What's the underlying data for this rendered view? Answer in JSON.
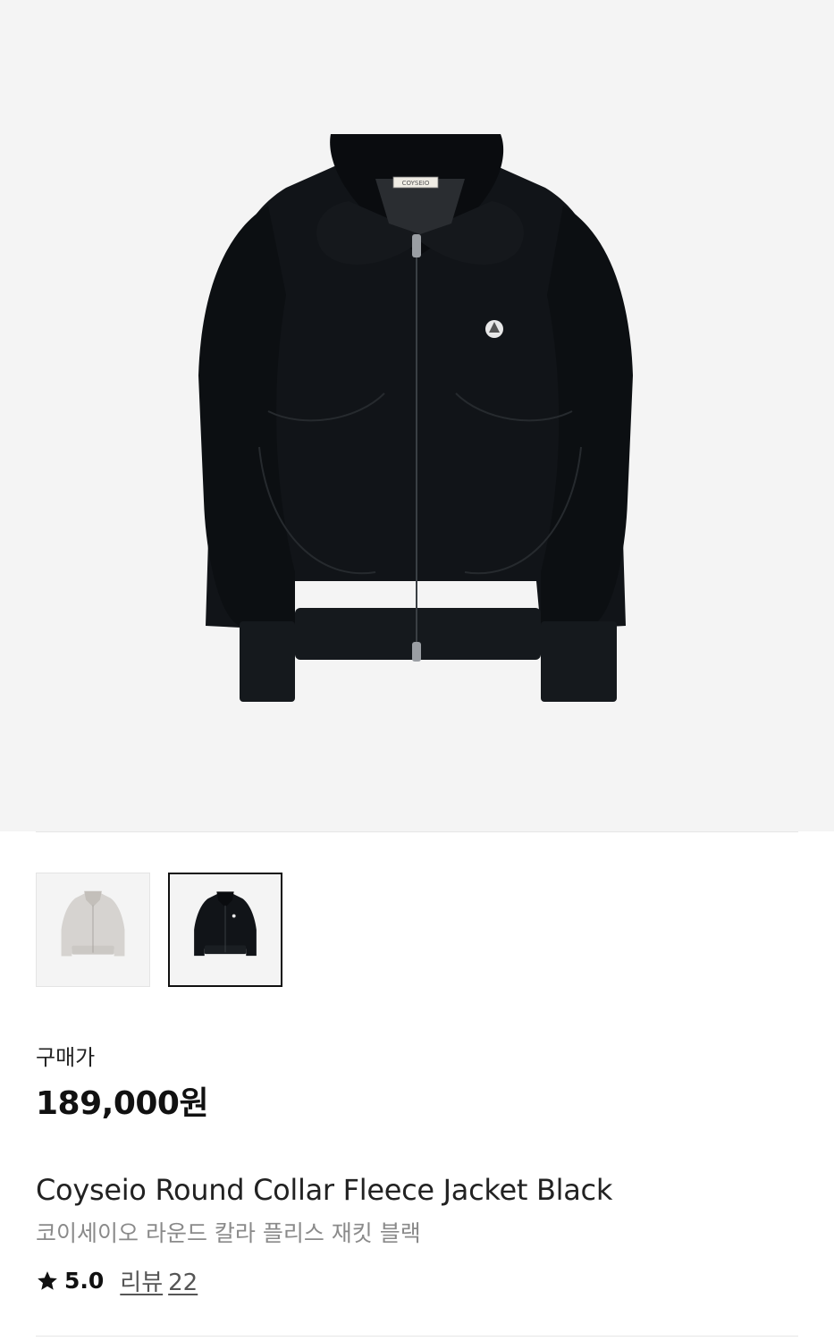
{
  "product": {
    "main_image": {
      "icon": "black-fleece-jacket-image",
      "background": "#f4f4f4"
    },
    "label_text": "COYSEIO",
    "thumbnails": [
      {
        "icon": "gray-jacket-thumbnail",
        "color": "#dcdad8",
        "selected": false
      },
      {
        "icon": "black-jacket-thumbnail",
        "color": "#111418",
        "selected": true
      }
    ],
    "price_label": "구매가",
    "price": "189,000원",
    "name_en": "Coyseio Round Collar Fleece Jacket Black",
    "name_ko": "코이세이오 라운드 칼라 플리스 재킷 블랙",
    "rating": {
      "icon": "star-icon",
      "score": "5.0",
      "reviews_label": "리뷰",
      "reviews_count": "22"
    }
  }
}
